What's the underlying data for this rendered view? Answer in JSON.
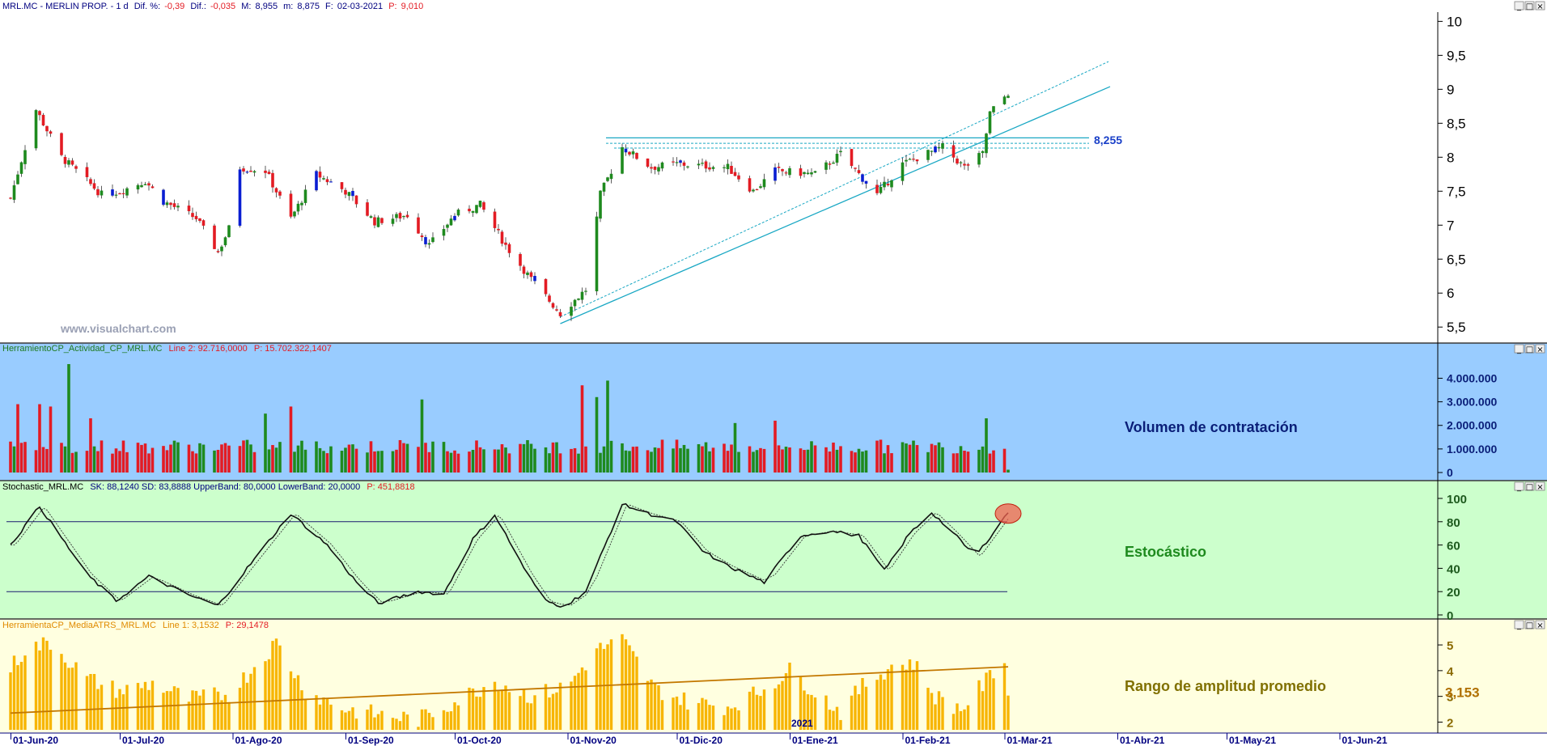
{
  "header": {
    "symbol": "MRL.MC - MERLIN PROP. -  1 d",
    "dif_pct_label": "Dif. %:",
    "dif_pct": "-0,39",
    "dif_label": "Dif.:",
    "dif": "-0,035",
    "max_label": "M:",
    "max": "8,955",
    "min_label": "m:",
    "min": "8,875",
    "date_label": "F:",
    "date": "02-03-2021",
    "price_label": "P:",
    "price": "9,010"
  },
  "watermark": "www.visualchart.com",
  "window_controls": [
    "_",
    "□",
    "×"
  ],
  "colors": {
    "up": "#1e8a1e",
    "down": "#e31b23",
    "blue_candle": "#0a1ed2",
    "trendline": "#1aa8c4",
    "volume_bg": "#99ccff",
    "stoch_bg": "#ccffcc",
    "atr_bg": "#ffffe0",
    "atr_bar": "#f7b500",
    "atr_avg": "#c37800"
  },
  "axis": {
    "x_ticks": [
      "01-Jun-20",
      "01-Jul-20",
      "01-Ago-20",
      "01-Sep-20",
      "01-Oct-20",
      "01-Nov-20",
      "01-Dic-20",
      "01-Ene-21",
      "01-Feb-21",
      "01-Mar-21",
      "01-Abr-21",
      "01-May-21",
      "01-Jun-21"
    ],
    "year_label": "2021"
  },
  "chart_data": [
    {
      "type": "candlestick",
      "name": "price",
      "y_ticks": [
        "10",
        "9,5",
        "9",
        "8,5",
        "8",
        "7,5",
        "7",
        "6,5",
        "6",
        "5,5"
      ],
      "ylim": [
        5.3,
        10.1
      ],
      "resistance_level": 8.255,
      "resistance_label": "8,255",
      "support_line": {
        "from": [
          "30-Oct-20",
          5.55
        ],
        "to": [
          "26-Feb-21",
          8.3
        ]
      },
      "support_line_inner": {
        "from": [
          "30-Oct-20",
          5.65
        ],
        "to": [
          "02-Mar-21",
          8.72
        ]
      },
      "anchors": [
        {
          "date": "01-Jun-20",
          "close": 7.4
        },
        {
          "date": "08-Jun-20",
          "close": 8.7
        },
        {
          "date": "15-Jun-20",
          "close": 8.0
        },
        {
          "date": "26-Jun-20",
          "close": 7.45
        },
        {
          "date": "01-Jul-20",
          "close": 7.5
        },
        {
          "date": "08-Jul-20",
          "close": 7.65
        },
        {
          "date": "13-Jul-20",
          "close": 7.35
        },
        {
          "date": "22-Jul-20",
          "close": 7.1
        },
        {
          "date": "28-Jul-20",
          "close": 6.6
        },
        {
          "date": "31-Jul-20",
          "close": 6.95
        },
        {
          "date": "03-Ago-20",
          "close": 7.85
        },
        {
          "date": "10-Ago-20",
          "close": 7.8
        },
        {
          "date": "17-Ago-20",
          "close": 7.1
        },
        {
          "date": "24-Ago-20",
          "close": 7.75
        },
        {
          "date": "01-Sep-20",
          "close": 7.5
        },
        {
          "date": "09-Sep-20",
          "close": 7.05
        },
        {
          "date": "18-Sep-20",
          "close": 7.15
        },
        {
          "date": "24-Sep-20",
          "close": 6.7
        },
        {
          "date": "01-Oct-20",
          "close": 7.15
        },
        {
          "date": "08-Oct-20",
          "close": 7.3
        },
        {
          "date": "15-Oct-20",
          "close": 6.7
        },
        {
          "date": "22-Oct-20",
          "close": 6.2
        },
        {
          "date": "30-Oct-20",
          "close": 5.7
        },
        {
          "date": "06-Nov-20",
          "close": 6.05
        },
        {
          "date": "10-Nov-20",
          "close": 7.45
        },
        {
          "date": "16-Nov-20",
          "close": 8.15
        },
        {
          "date": "24-Nov-20",
          "close": 7.85
        },
        {
          "date": "01-Dic-20",
          "close": 7.9
        },
        {
          "date": "15-Dic-20",
          "close": 7.85
        },
        {
          "date": "22-Dic-20",
          "close": 7.5
        },
        {
          "date": "28-Dic-20",
          "close": 7.8
        },
        {
          "date": "08-Ene-21",
          "close": 7.75
        },
        {
          "date": "15-Ene-21",
          "close": 8.05
        },
        {
          "date": "25-Ene-21",
          "close": 7.45
        },
        {
          "date": "01-Feb-21",
          "close": 7.9
        },
        {
          "date": "12-Feb-21",
          "close": 8.15
        },
        {
          "date": "18-Feb-21",
          "close": 7.85
        },
        {
          "date": "23-Feb-21",
          "close": 8.05
        },
        {
          "date": "25-Feb-21",
          "close": 8.65
        },
        {
          "date": "02-Mar-21",
          "close": 8.95
        }
      ]
    },
    {
      "type": "bar",
      "name": "HerramientoCP_Actividad_CP_MRL.MC",
      "info": "Line 2: 92.716,0000",
      "info_p": "P: 15.702.322,1407",
      "title": "Volumen de contratación",
      "y_ticks": [
        "4.000.000",
        "3.000.000",
        "2.000.000",
        "1.000.000",
        "0"
      ],
      "ylim": [
        0,
        4600000
      ]
    },
    {
      "type": "line",
      "name": "Stochastic_MRL.MC",
      "info": "SK: 88,1240  SD: 83,8888  UpperBand: 80,0000  LowerBand: 20,0000",
      "info_p": "P: 451,8818",
      "title": "Estocástico",
      "y_ticks": [
        "100",
        "80",
        "60",
        "40",
        "20",
        "0"
      ],
      "ylim": [
        0,
        100
      ],
      "upper_band": 80,
      "lower_band": 20,
      "anchors": [
        {
          "date": "01-Jun-20",
          "value": 60
        },
        {
          "date": "09-Jun-20",
          "value": 93
        },
        {
          "date": "22-Jun-20",
          "value": 35
        },
        {
          "date": "30-Jun-20",
          "value": 12
        },
        {
          "date": "09-Jul-20",
          "value": 33
        },
        {
          "date": "20-Jul-20",
          "value": 17
        },
        {
          "date": "28-Jul-20",
          "value": 8
        },
        {
          "date": "05-Ago-20",
          "value": 40
        },
        {
          "date": "17-Ago-20",
          "value": 87
        },
        {
          "date": "27-Ago-20",
          "value": 60
        },
        {
          "date": "04-Sep-20",
          "value": 28
        },
        {
          "date": "10-Sep-20",
          "value": 10
        },
        {
          "date": "21-Sep-20",
          "value": 20
        },
        {
          "date": "28-Sep-20",
          "value": 18
        },
        {
          "date": "06-Oct-20",
          "value": 65
        },
        {
          "date": "12-Oct-20",
          "value": 86
        },
        {
          "date": "21-Oct-20",
          "value": 35
        },
        {
          "date": "26-Oct-20",
          "value": 12
        },
        {
          "date": "31-Oct-20",
          "value": 7
        },
        {
          "date": "06-Nov-20",
          "value": 20
        },
        {
          "date": "16-Nov-20",
          "value": 95
        },
        {
          "date": "23-Nov-20",
          "value": 87
        },
        {
          "date": "01-Dic-20",
          "value": 80
        },
        {
          "date": "08-Dic-20",
          "value": 55
        },
        {
          "date": "15-Dic-20",
          "value": 42
        },
        {
          "date": "25-Dic-20",
          "value": 28
        },
        {
          "date": "04-Ene-21",
          "value": 68
        },
        {
          "date": "12-Ene-21",
          "value": 72
        },
        {
          "date": "20-Ene-21",
          "value": 68
        },
        {
          "date": "27-Ene-21",
          "value": 38
        },
        {
          "date": "03-Feb-21",
          "value": 70
        },
        {
          "date": "09-Feb-21",
          "value": 88
        },
        {
          "date": "15-Feb-21",
          "value": 70
        },
        {
          "date": "21-Feb-21",
          "value": 50
        },
        {
          "date": "02-Mar-21",
          "value": 88
        }
      ]
    },
    {
      "type": "bar",
      "name": "HerramientaCP_MediaATRS_MRL.MC",
      "info": "Line 1: 3,1532",
      "info_p": "P: 29,1478",
      "title": "Rango de amplitud promedio",
      "value_label": "3,153",
      "y_ticks": [
        "5",
        "4",
        "3",
        "2"
      ],
      "ylim": [
        1.7,
        5.6
      ],
      "average_line": {
        "from": 2.35,
        "to": 4.15
      }
    }
  ]
}
